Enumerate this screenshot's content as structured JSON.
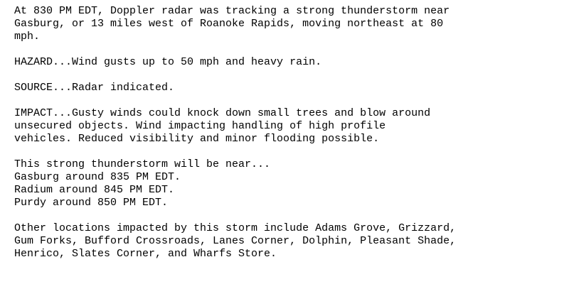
{
  "bulletin": {
    "overview": [
      "At 830 PM EDT, Doppler radar was tracking a strong thunderstorm near",
      "Gasburg, or 13 miles west of Roanoke Rapids, moving northeast at 80",
      "mph."
    ],
    "hazard": [
      "HAZARD...Wind gusts up to 50 mph and heavy rain."
    ],
    "source": [
      "SOURCE...Radar indicated."
    ],
    "impact": [
      "IMPACT...Gusty winds could knock down small trees and blow around",
      "unsecured objects. Wind impacting handling of high profile",
      "vehicles. Reduced visibility and minor flooding possible."
    ],
    "timeline": [
      "This strong thunderstorm will be near...",
      "Gasburg around 835 PM EDT.",
      "Radium around 845 PM EDT.",
      "Purdy around 850 PM EDT."
    ],
    "other_locations": [
      "Other locations impacted by this storm include Adams Grove, Grizzard,",
      "Gum Forks, Bufford Crossroads, Lanes Corner, Dolphin, Pleasant Shade,",
      "Henrico, Slates Corner, and Wharfs Store."
    ]
  }
}
